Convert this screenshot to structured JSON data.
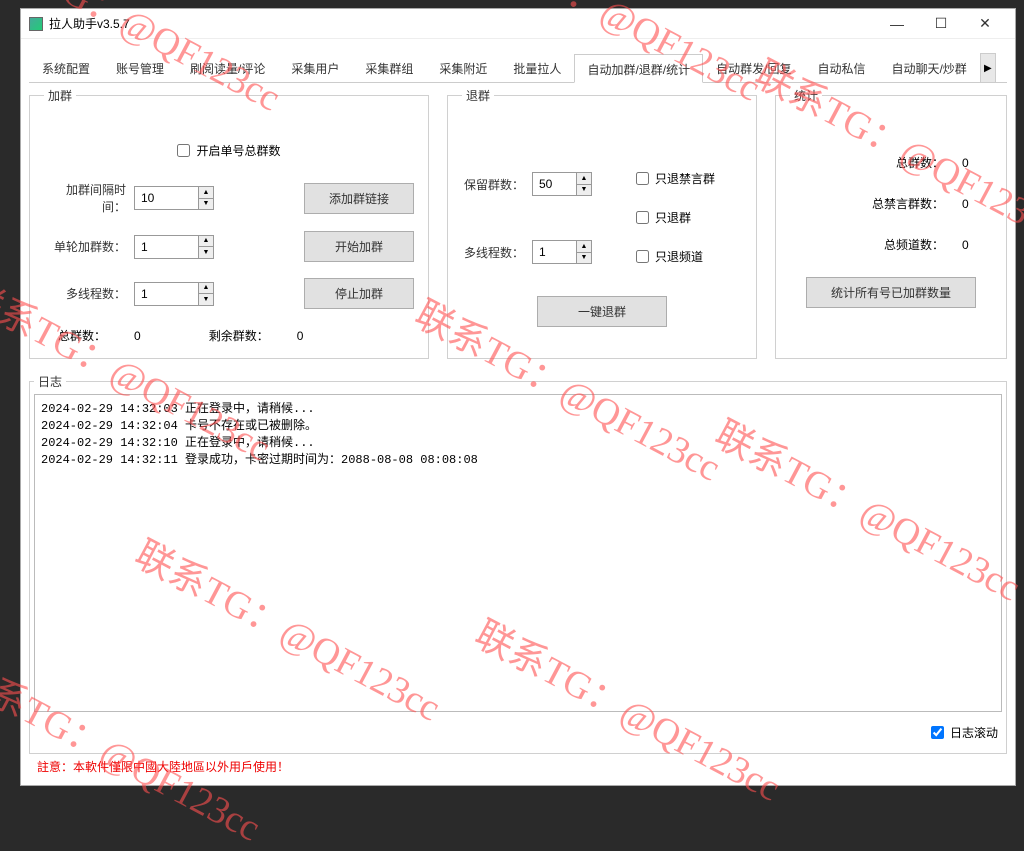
{
  "window": {
    "title": "拉人助手v3.5.7"
  },
  "tabs": [
    "系统配置",
    "账号管理",
    "刷阅读量/评论",
    "采集用户",
    "采集群组",
    "采集附近",
    "批量拉人",
    "自动加群/退群/统计",
    "自动群发/回复",
    "自动私信",
    "自动聊天/炒群"
  ],
  "active_tab": 7,
  "join": {
    "legend": "加群",
    "enable_single_total": "开启单号总群数",
    "interval_label": "加群间隔时间：",
    "interval_value": "10",
    "round_label": "单轮加群数：",
    "round_value": "1",
    "threads_label": "多线程数：",
    "threads_value": "1",
    "btn_add_link": "添加群链接",
    "btn_start": "开始加群",
    "btn_stop": "停止加群",
    "total_label": "总群数：",
    "total_value": "0",
    "remain_label": "剩余群数：",
    "remain_value": "0"
  },
  "quit": {
    "legend": "退群",
    "keep_label": "保留群数：",
    "keep_value": "50",
    "threads_label": "多线程数：",
    "threads_value": "1",
    "only_banned": "只退禁言群",
    "only_group": "只退群",
    "only_channel": "只退频道",
    "btn_quit": "一键退群"
  },
  "stats": {
    "legend": "统计",
    "total_groups_label": "总群数：",
    "total_groups_value": "0",
    "banned_label": "总禁言群数：",
    "banned_value": "0",
    "channels_label": "总频道数：",
    "channels_value": "0",
    "btn_calc": "统计所有号已加群数量"
  },
  "log": {
    "legend": "日志",
    "scroll_label": "日志滚动",
    "lines": [
      "2024-02-29 14:32:03 正在登录中，请稍候...",
      "2024-02-29 14:32:04 卡号不存在或已被删除。",
      "2024-02-29 14:32:10 正在登录中，请稍候...",
      "2024-02-29 14:32:11 登录成功，卡密过期时间为：2088-08-08 08:08:08"
    ]
  },
  "warning": "註意：本軟件僅限中國大陸地區以外用戶使用！",
  "watermark": "联系TG：@QF123cc"
}
